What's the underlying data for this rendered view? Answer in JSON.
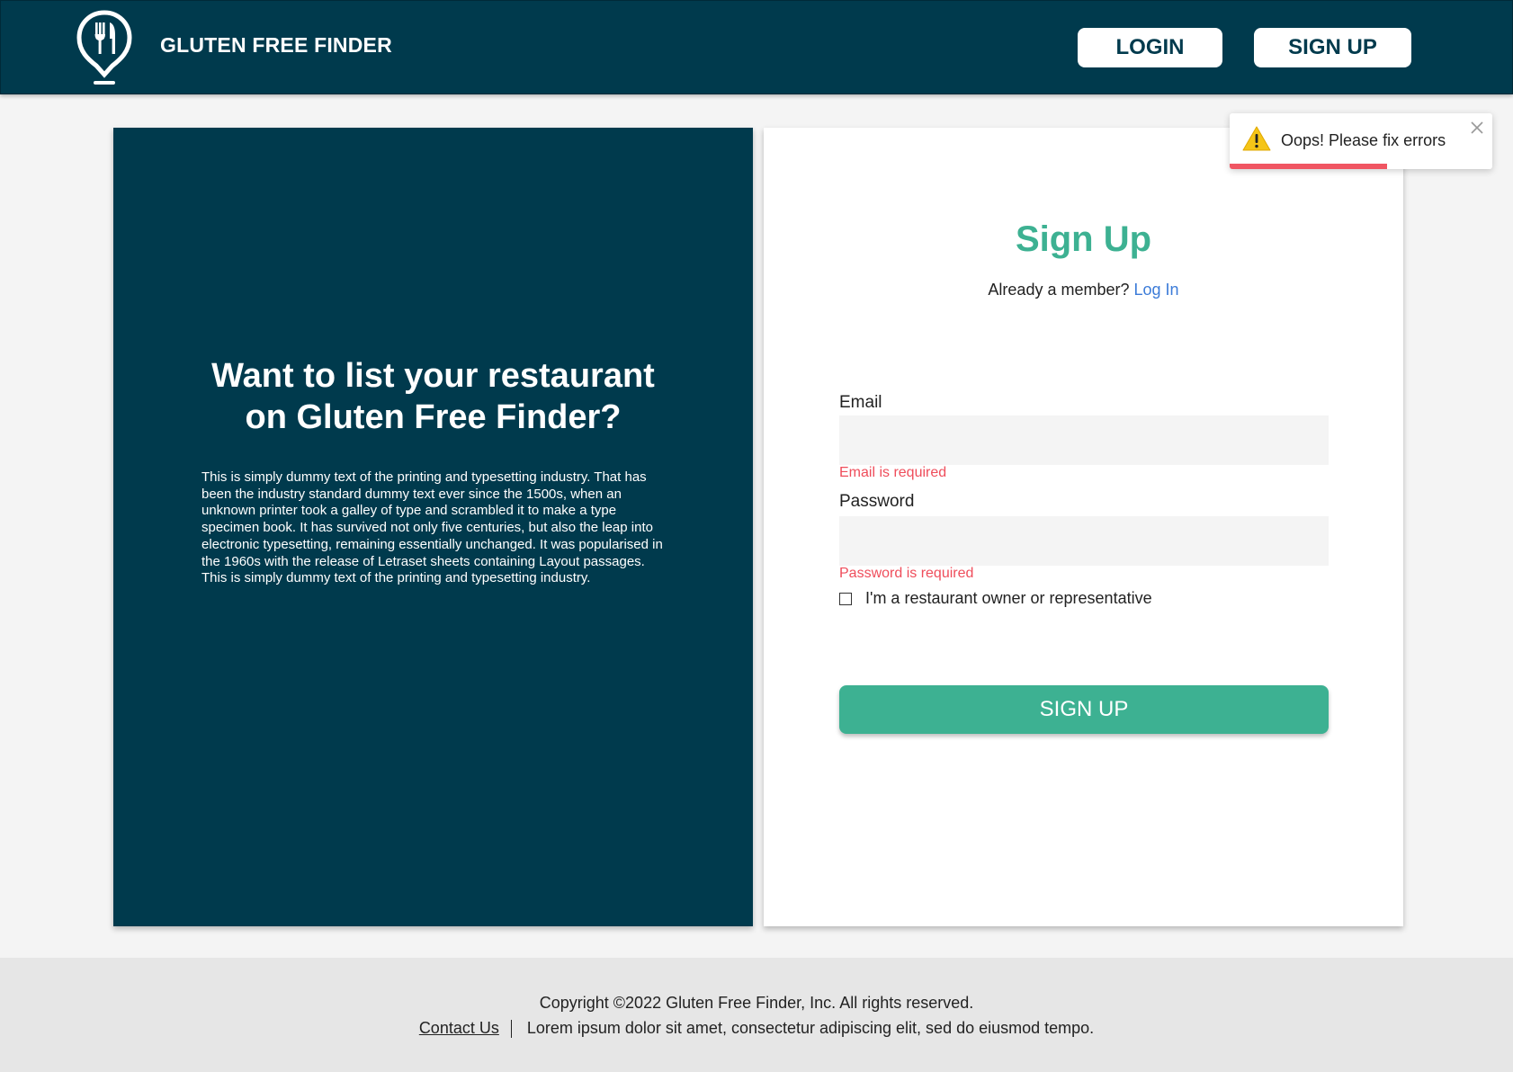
{
  "header": {
    "brand": "GLUTEN FREE FINDER",
    "login_label": "LOGIN",
    "signup_label": "SIGN UP"
  },
  "left": {
    "title_line1": "Want to list your restaurant",
    "title_line2": "on Gluten Free Finder?",
    "body": "This is simply dummy text of the printing and typesetting industry. That has been the industry standard dummy text ever since the 1500s, when an unknown printer took a galley of type and scrambled it to make a type specimen book. It has survived not only five centuries, but also the leap into electronic typesetting, remaining essentially unchanged. It was popularised in the 1960s with the release of Letraset sheets containing Layout passages. This is simply dummy text of the printing and typesetting industry."
  },
  "form": {
    "title": "Sign Up",
    "member_text": "Already a member?",
    "login_link": "Log In",
    "email_label": "Email",
    "email_value": "",
    "email_error": "Email is required",
    "password_label": "Password",
    "password_value": "",
    "password_error": "Password is required",
    "checkbox_label": "I'm a restaurant owner or representative",
    "checkbox_checked": false,
    "submit_label": "SIGN UP"
  },
  "toast": {
    "message": "Oops! Please fix errors",
    "icon": "warning-icon",
    "progress": 0.6
  },
  "footer": {
    "copyright": "Copyright ©2022 Gluten Free Finder, Inc. All rights reserved.",
    "contact": "Contact Us",
    "tagline": "Lorem ipsum dolor sit amet, consectetur adipiscing elit, sed do eiusmod tempo."
  },
  "colors": {
    "navy": "#003a4d",
    "accent_green": "#3db192",
    "link_blue": "#3b7bd8",
    "error_red": "#ef4d5b",
    "warning_yellow": "#f5c518"
  }
}
